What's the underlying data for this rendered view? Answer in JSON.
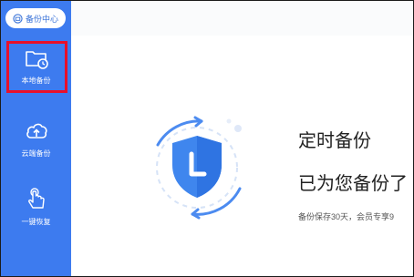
{
  "header": {
    "backup_center_label": "备份中心"
  },
  "sidebar": {
    "items": [
      {
        "label": "本地备份",
        "icon": "folder-clock-icon",
        "active": true
      },
      {
        "label": "云端备份",
        "icon": "cloud-upload-icon",
        "active": false
      },
      {
        "label": "一键恢复",
        "icon": "hand-tap-icon",
        "active": false
      }
    ]
  },
  "main": {
    "title": "定时备份",
    "subtitle": "已为您备份了",
    "note": "备份保存30天，会员专享9"
  },
  "colors": {
    "sidebar": "#3d7bef",
    "accent": "#3a73d8",
    "highlight": "#e8102a"
  }
}
